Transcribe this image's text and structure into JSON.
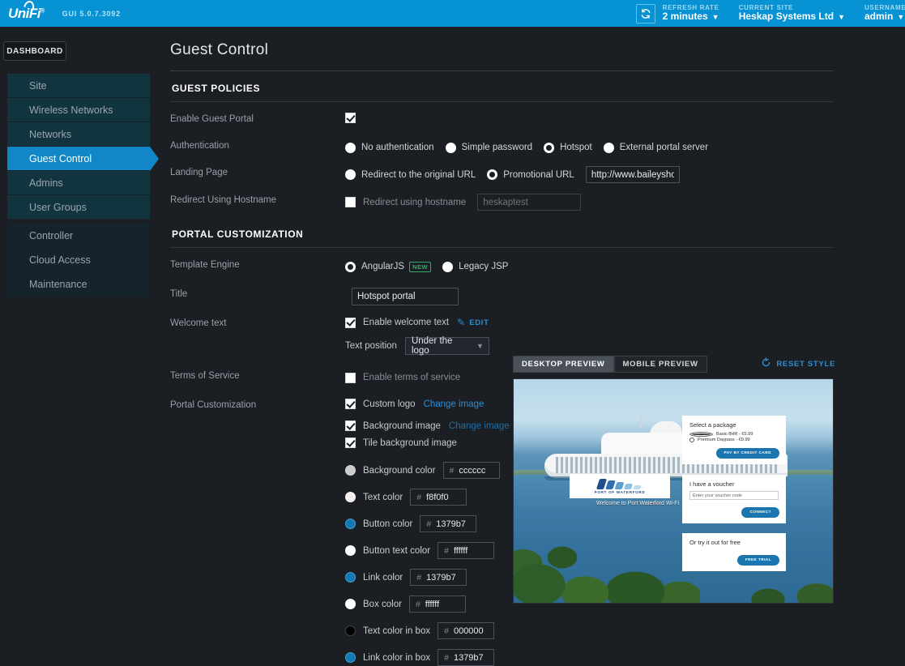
{
  "topbar": {
    "logo_text": "UniFi",
    "gui_version": "GUI 5.0.7.3092",
    "refresh_icon": "refresh-icon",
    "refresh_rate_label": "REFRESH RATE",
    "refresh_rate_value": "2 minutes",
    "current_site_label": "CURRENT SITE",
    "current_site_value": "Heskap Systems Ltd",
    "username_label": "USERNAME",
    "username_value": "admin",
    "accent_color": "#0792d3"
  },
  "sidebar": {
    "dashboard_label": "DASHBOARD",
    "items": [
      {
        "label": "Site",
        "active": false
      },
      {
        "label": "Wireless Networks",
        "active": false
      },
      {
        "label": "Networks",
        "active": false
      },
      {
        "label": "Guest Control",
        "active": true
      },
      {
        "label": "Admins",
        "active": false
      },
      {
        "label": "User Groups",
        "active": false
      },
      {
        "label": "Controller",
        "active": false
      },
      {
        "label": "Cloud Access",
        "active": false
      },
      {
        "label": "Maintenance",
        "active": false
      }
    ]
  },
  "page": {
    "title": "Guest Control"
  },
  "guest_policies": {
    "heading": "GUEST POLICIES",
    "enable_guest_portal": {
      "label": "Enable Guest Portal",
      "checked": true
    },
    "authentication": {
      "label": "Authentication",
      "options": [
        {
          "label": "No authentication",
          "selected": false
        },
        {
          "label": "Simple password",
          "selected": false
        },
        {
          "label": "Hotspot",
          "selected": true
        },
        {
          "label": "External portal server",
          "selected": false
        }
      ]
    },
    "landing_page": {
      "label": "Landing Page",
      "options": [
        {
          "label": "Redirect to the original URL",
          "selected": false
        },
        {
          "label": "Promotional URL",
          "selected": true
        }
      ],
      "url_value": "http://www.baileyshotelc"
    },
    "redirect_hostname": {
      "label": "Redirect Using Hostname",
      "checkbox_label": "Redirect using hostname",
      "checked": false,
      "hostname_placeholder": "heskaptest"
    }
  },
  "portal_customization": {
    "heading": "PORTAL CUSTOMIZATION",
    "template_engine": {
      "label": "Template Engine",
      "options": [
        {
          "label": "AngularJS",
          "selected": true,
          "badge": "NEW"
        },
        {
          "label": "Legacy JSP",
          "selected": false
        }
      ]
    },
    "title": {
      "label": "Title",
      "value": "Hotspot portal"
    },
    "welcome_text": {
      "label": "Welcome text",
      "checkbox_label": "Enable welcome text",
      "checked": true,
      "edit_label": "EDIT",
      "position_label": "Text position",
      "position_value": "Under the logo"
    },
    "terms_of_service": {
      "label": "Terms of Service",
      "checkbox_label": "Enable terms of service",
      "checked": false
    },
    "customization": {
      "label": "Portal Customization",
      "custom_logo": {
        "label": "Custom logo",
        "checked": true,
        "link": "Change image"
      },
      "background_image": {
        "label": "Background image",
        "checked": true,
        "link": "Change image"
      },
      "tile_background": {
        "label": "Tile background image",
        "checked": true
      },
      "colors": [
        {
          "name": "Background color",
          "hex": "cccccc",
          "swatch": "#cccccc"
        },
        {
          "name": "Text color",
          "hex": "f8f0f0",
          "swatch": "#f8f0f0"
        },
        {
          "name": "Button color",
          "hex": "1379b7",
          "swatch": "#1379b7"
        },
        {
          "name": "Button text color",
          "hex": "ffffff",
          "swatch": "#ffffff"
        },
        {
          "name": "Link color",
          "hex": "1379b7",
          "swatch": "#1379b7"
        },
        {
          "name": "Box color",
          "hex": "ffffff",
          "swatch": "#ffffff"
        },
        {
          "name": "Text color in box",
          "hex": "000000",
          "swatch": "#000000"
        },
        {
          "name": "Link color in box",
          "hex": "1379b7",
          "swatch": "#1379b7"
        }
      ]
    }
  },
  "preview": {
    "tabs": [
      {
        "label": "DESKTOP PREVIEW",
        "active": true
      },
      {
        "label": "MOBILE PREVIEW",
        "active": false
      }
    ],
    "reset_label": "RESET STYLE",
    "reset_icon": "reset-circular-arrow-icon",
    "portal": {
      "logo_caption": "PORT OF WATERFORD",
      "welcome_text": "Welcome to Port Waterford Wi-Fi",
      "package_box": {
        "title": "Select a package",
        "options": [
          {
            "label": "Basic 8HR - €5.99",
            "selected": true
          },
          {
            "label": "Premium Daypass - €9.99",
            "selected": false
          }
        ],
        "button": "PAY BY CREDIT CARD"
      },
      "voucher_box": {
        "title": "I have a voucher",
        "placeholder": "Enter your voucher code",
        "button": "CONNECT"
      },
      "free_box": {
        "title": "Or try it out for free",
        "button": "FREE TRIAL"
      }
    }
  }
}
